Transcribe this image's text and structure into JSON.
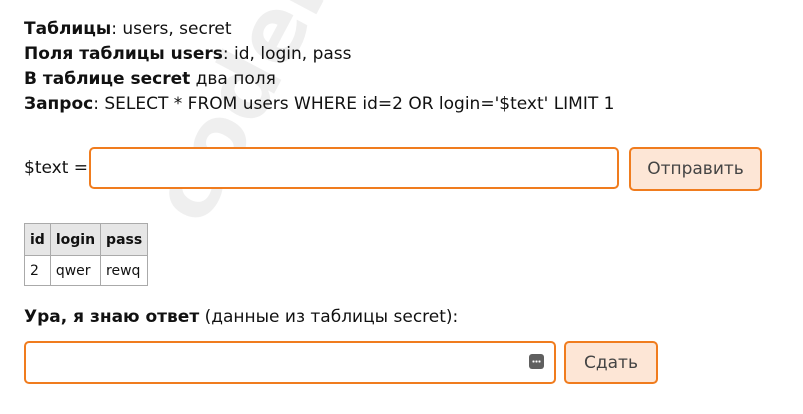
{
  "watermark": "codeby.net",
  "info": {
    "tables_label": "Таблицы",
    "tables_value": ": users, secret",
    "fields_label": "Поля таблицы users",
    "fields_value": ": id, login, pass",
    "secret_label": "В таблице secret",
    "secret_value": " два поля",
    "query_label": "Запрос",
    "query_value": ": SELECT * FROM users WHERE id=2 OR login='$text' LIMIT 1"
  },
  "form": {
    "text_label": "$text =",
    "text_value": "",
    "send_label": "Отправить"
  },
  "table": {
    "headers": [
      "id",
      "login",
      "pass"
    ],
    "rows": [
      [
        "2",
        "qwer",
        "rewq"
      ]
    ]
  },
  "answer": {
    "label_bold": "Ура, я знаю ответ",
    "label_rest": " (данные из таблицы secret):",
    "value": "",
    "submit_label": "Сдать"
  },
  "colors": {
    "accent": "#f07c1e",
    "button_bg": "#fde6d6",
    "table_header_bg": "#e6e6e6"
  }
}
